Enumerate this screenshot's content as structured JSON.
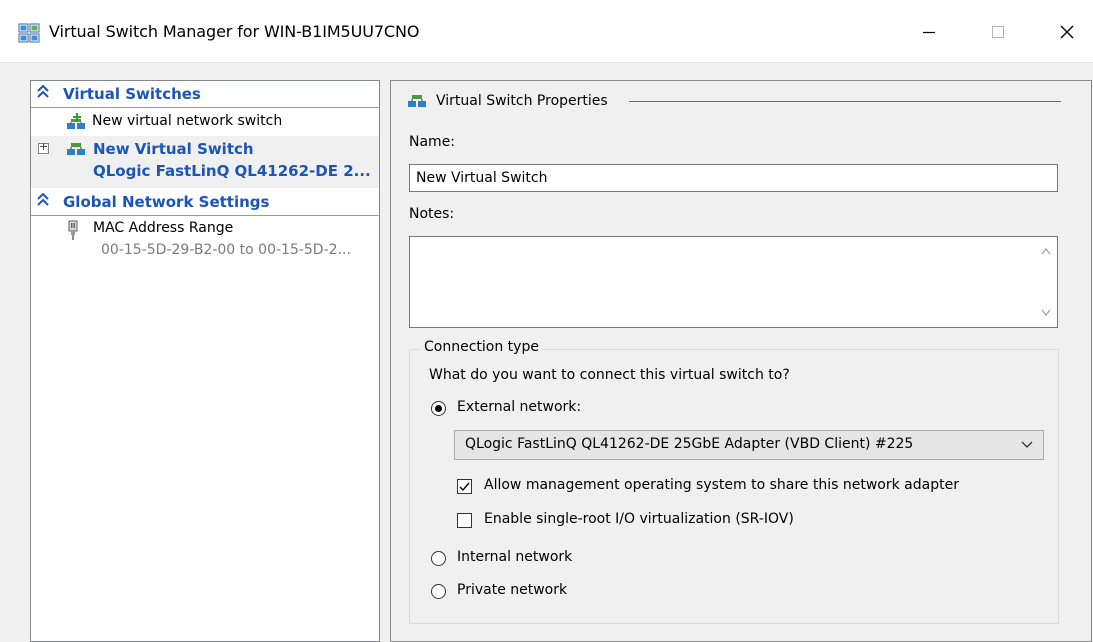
{
  "window": {
    "title": "Virtual Switch Manager for WIN-B1IM5UU7CNO",
    "minimize_glyph": "—",
    "maximize_glyph": "☐",
    "close_glyph": "✕"
  },
  "left": {
    "virtual_switches_header": "Virtual Switches",
    "new_switch_item": "New virtual network switch",
    "switch_name": "New Virtual Switch",
    "switch_adapter": "QLogic FastLinQ QL41262-DE 2...",
    "expand_glyph": "+",
    "global_header": "Global Network Settings",
    "mac_label": "MAC Address Range",
    "mac_value": "00-15-5D-29-B2-00 to 00-15-5D-2..."
  },
  "right": {
    "group_title": "Virtual Switch Properties",
    "name_label": "Name:",
    "name_value": "New Virtual Switch",
    "notes_label": "Notes:",
    "notes_value": "",
    "connection": {
      "group_title": "Connection type",
      "question": "What do you want to connect this virtual switch to?",
      "external_label": "External network:",
      "external_selected": true,
      "adapter_selected": "QLogic FastLinQ QL41262-DE 25GbE Adapter (VBD Client) #225",
      "allow_mgmt_label": "Allow management operating system to share this network adapter",
      "allow_mgmt_checked": true,
      "sriov_label": "Enable single-root I/O virtualization (SR-IOV)",
      "sriov_checked": false,
      "internal_label": "Internal network",
      "private_label": "Private network"
    }
  },
  "colors": {
    "accent_blue": "#1a55b7",
    "header_rule": "#7a9fd6"
  }
}
